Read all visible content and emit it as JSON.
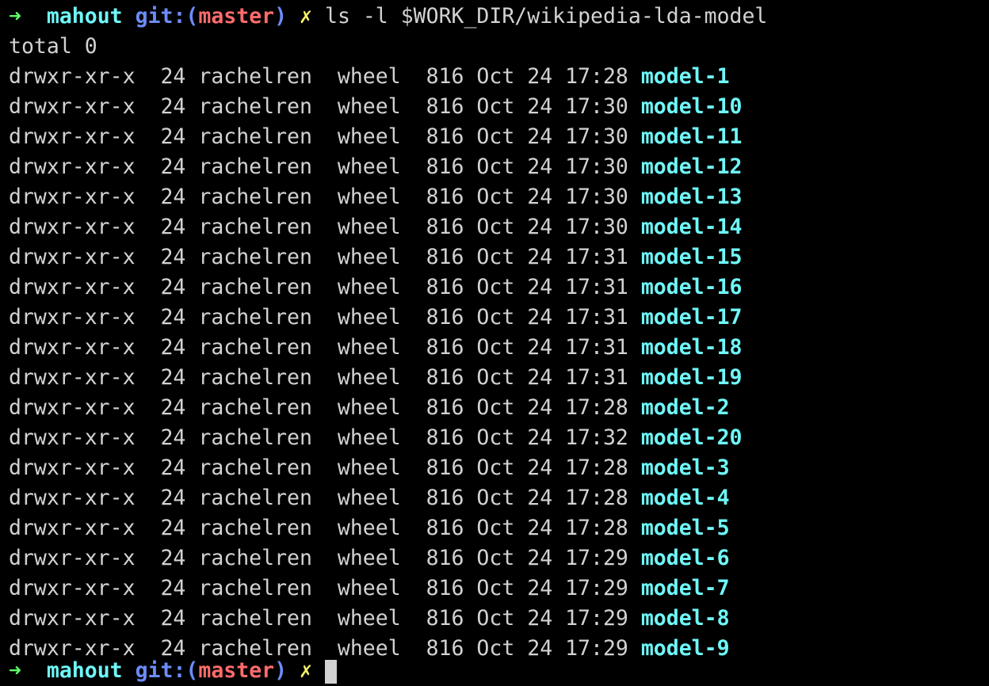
{
  "colors": {
    "background": "#000000",
    "text": "#d2d2d2",
    "prompt_arrow": "#5ff967",
    "prompt_dir": "#6ff7f8",
    "git_label": "#6c8cf9",
    "branch": "#ff6b6b",
    "dirty_mark": "#f5f26a",
    "directory_entry": "#6ff7f8"
  },
  "prompt": {
    "arrow": "➜",
    "dir": "mahout",
    "git_prefix": "git:(",
    "branch": "master",
    "git_suffix": ")",
    "dirty": "✗",
    "command": "ls -l $WORK_DIR/wikipedia-lda-model"
  },
  "total_line": "total 0",
  "entries": [
    {
      "perms": "drwxr-xr-x",
      "links": "24",
      "owner": "rachelren",
      "group": "wheel",
      "size": "816",
      "date": "Oct 24 17:28",
      "name": "model-1"
    },
    {
      "perms": "drwxr-xr-x",
      "links": "24",
      "owner": "rachelren",
      "group": "wheel",
      "size": "816",
      "date": "Oct 24 17:30",
      "name": "model-10"
    },
    {
      "perms": "drwxr-xr-x",
      "links": "24",
      "owner": "rachelren",
      "group": "wheel",
      "size": "816",
      "date": "Oct 24 17:30",
      "name": "model-11"
    },
    {
      "perms": "drwxr-xr-x",
      "links": "24",
      "owner": "rachelren",
      "group": "wheel",
      "size": "816",
      "date": "Oct 24 17:30",
      "name": "model-12"
    },
    {
      "perms": "drwxr-xr-x",
      "links": "24",
      "owner": "rachelren",
      "group": "wheel",
      "size": "816",
      "date": "Oct 24 17:30",
      "name": "model-13"
    },
    {
      "perms": "drwxr-xr-x",
      "links": "24",
      "owner": "rachelren",
      "group": "wheel",
      "size": "816",
      "date": "Oct 24 17:30",
      "name": "model-14"
    },
    {
      "perms": "drwxr-xr-x",
      "links": "24",
      "owner": "rachelren",
      "group": "wheel",
      "size": "816",
      "date": "Oct 24 17:31",
      "name": "model-15"
    },
    {
      "perms": "drwxr-xr-x",
      "links": "24",
      "owner": "rachelren",
      "group": "wheel",
      "size": "816",
      "date": "Oct 24 17:31",
      "name": "model-16"
    },
    {
      "perms": "drwxr-xr-x",
      "links": "24",
      "owner": "rachelren",
      "group": "wheel",
      "size": "816",
      "date": "Oct 24 17:31",
      "name": "model-17"
    },
    {
      "perms": "drwxr-xr-x",
      "links": "24",
      "owner": "rachelren",
      "group": "wheel",
      "size": "816",
      "date": "Oct 24 17:31",
      "name": "model-18"
    },
    {
      "perms": "drwxr-xr-x",
      "links": "24",
      "owner": "rachelren",
      "group": "wheel",
      "size": "816",
      "date": "Oct 24 17:31",
      "name": "model-19"
    },
    {
      "perms": "drwxr-xr-x",
      "links": "24",
      "owner": "rachelren",
      "group": "wheel",
      "size": "816",
      "date": "Oct 24 17:28",
      "name": "model-2"
    },
    {
      "perms": "drwxr-xr-x",
      "links": "24",
      "owner": "rachelren",
      "group": "wheel",
      "size": "816",
      "date": "Oct 24 17:32",
      "name": "model-20"
    },
    {
      "perms": "drwxr-xr-x",
      "links": "24",
      "owner": "rachelren",
      "group": "wheel",
      "size": "816",
      "date": "Oct 24 17:28",
      "name": "model-3"
    },
    {
      "perms": "drwxr-xr-x",
      "links": "24",
      "owner": "rachelren",
      "group": "wheel",
      "size": "816",
      "date": "Oct 24 17:28",
      "name": "model-4"
    },
    {
      "perms": "drwxr-xr-x",
      "links": "24",
      "owner": "rachelren",
      "group": "wheel",
      "size": "816",
      "date": "Oct 24 17:28",
      "name": "model-5"
    },
    {
      "perms": "drwxr-xr-x",
      "links": "24",
      "owner": "rachelren",
      "group": "wheel",
      "size": "816",
      "date": "Oct 24 17:29",
      "name": "model-6"
    },
    {
      "perms": "drwxr-xr-x",
      "links": "24",
      "owner": "rachelren",
      "group": "wheel",
      "size": "816",
      "date": "Oct 24 17:29",
      "name": "model-7"
    },
    {
      "perms": "drwxr-xr-x",
      "links": "24",
      "owner": "rachelren",
      "group": "wheel",
      "size": "816",
      "date": "Oct 24 17:29",
      "name": "model-8"
    },
    {
      "perms": "drwxr-xr-x",
      "links": "24",
      "owner": "rachelren",
      "group": "wheel",
      "size": "816",
      "date": "Oct 24 17:29",
      "name": "model-9"
    }
  ],
  "next_prompt": {
    "arrow": "➜",
    "dir": "mahout",
    "git_prefix": "git:(",
    "branch": "master",
    "git_suffix": ")",
    "dirty": "✗"
  }
}
